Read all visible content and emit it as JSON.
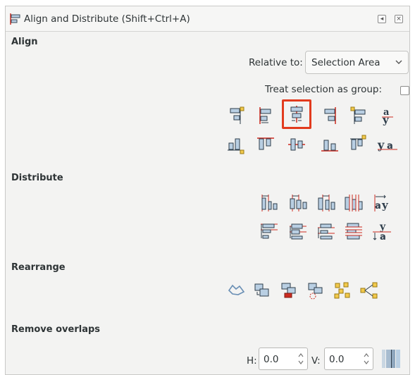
{
  "panel": {
    "title": "Align and Distribute (Shift+Ctrl+A)",
    "title_buttons": [
      "menu-icon",
      "close-icon"
    ]
  },
  "align": {
    "heading": "Align",
    "relative_to_label": "Relative to:",
    "relative_to_value": "Selection Area",
    "treat_group_label": "Treat selection as group:",
    "treat_group_checked": false,
    "row1_icons": [
      "align-right-edges-to-anchor-left-icon",
      "align-left-edges-icon",
      "center-on-vertical-axis-icon",
      "align-right-edges-icon",
      "align-left-edges-to-anchor-right-icon",
      "align-baselines-text-icon"
    ],
    "row2_icons": [
      "align-bottom-edges-to-anchor-top-icon",
      "align-top-edges-icon",
      "center-on-horizontal-axis-icon",
      "align-bottom-edges-icon",
      "align-top-edges-to-anchor-bottom-icon",
      "align-baseline-anchors-icon"
    ],
    "selected_icon": "center-on-vertical-axis-icon"
  },
  "distribute": {
    "heading": "Distribute",
    "row1_icons": [
      "distribute-left-edges-icon",
      "distribute-centers-horizontally-icon",
      "distribute-right-edges-icon",
      "distribute-horizontal-gaps-icon",
      "distribute-baselines-horizontally-icon"
    ],
    "row2_icons": [
      "distribute-top-edges-icon",
      "distribute-centers-vertically-icon",
      "distribute-bottom-edges-icon",
      "distribute-vertical-gaps-icon",
      "distribute-baselines-vertically-icon"
    ]
  },
  "rearrange": {
    "heading": "Rearrange",
    "icons": [
      "graph-layout-icon",
      "exchange-selection-order-icon",
      "exchange-z-order-icon",
      "rotate-around-center-icon",
      "randomize-positions-icon",
      "unclump-icon"
    ]
  },
  "remove_overlaps": {
    "heading": "Remove overlaps",
    "h_label": "H:",
    "h_value": "0.0",
    "v_label": "V:",
    "v_value": "0.0",
    "apply_icon": "remove-overlaps-icon"
  },
  "colors": {
    "accent_red": "#e23b1e",
    "object_fill": "#b9cfe3",
    "guide_red": "#cc2b20",
    "anchor_yellow": "#f2c94c"
  }
}
